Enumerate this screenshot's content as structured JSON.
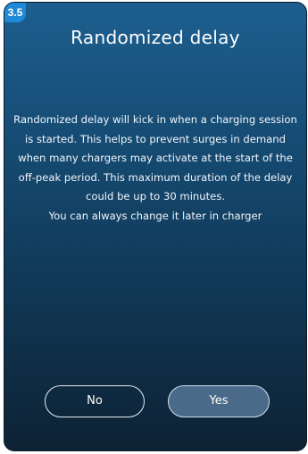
{
  "step": {
    "label": "3.5"
  },
  "dialog": {
    "title": "Randomized delay",
    "body": "Randomized delay will kick in when a charging session is started. This helps to prevent surges in demand when many chargers may activate at the start of the off-peak period. This maximum duration of the delay could be up to 30 minutes.",
    "note": "You can always change it later in charger"
  },
  "buttons": {
    "no_label": "No",
    "yes_label": "Yes"
  },
  "colors": {
    "badge": "#1f8ad8",
    "background_top": "#1d5f90",
    "background_bottom": "#0d2234",
    "yes_button_fill": "#4a6a89"
  }
}
